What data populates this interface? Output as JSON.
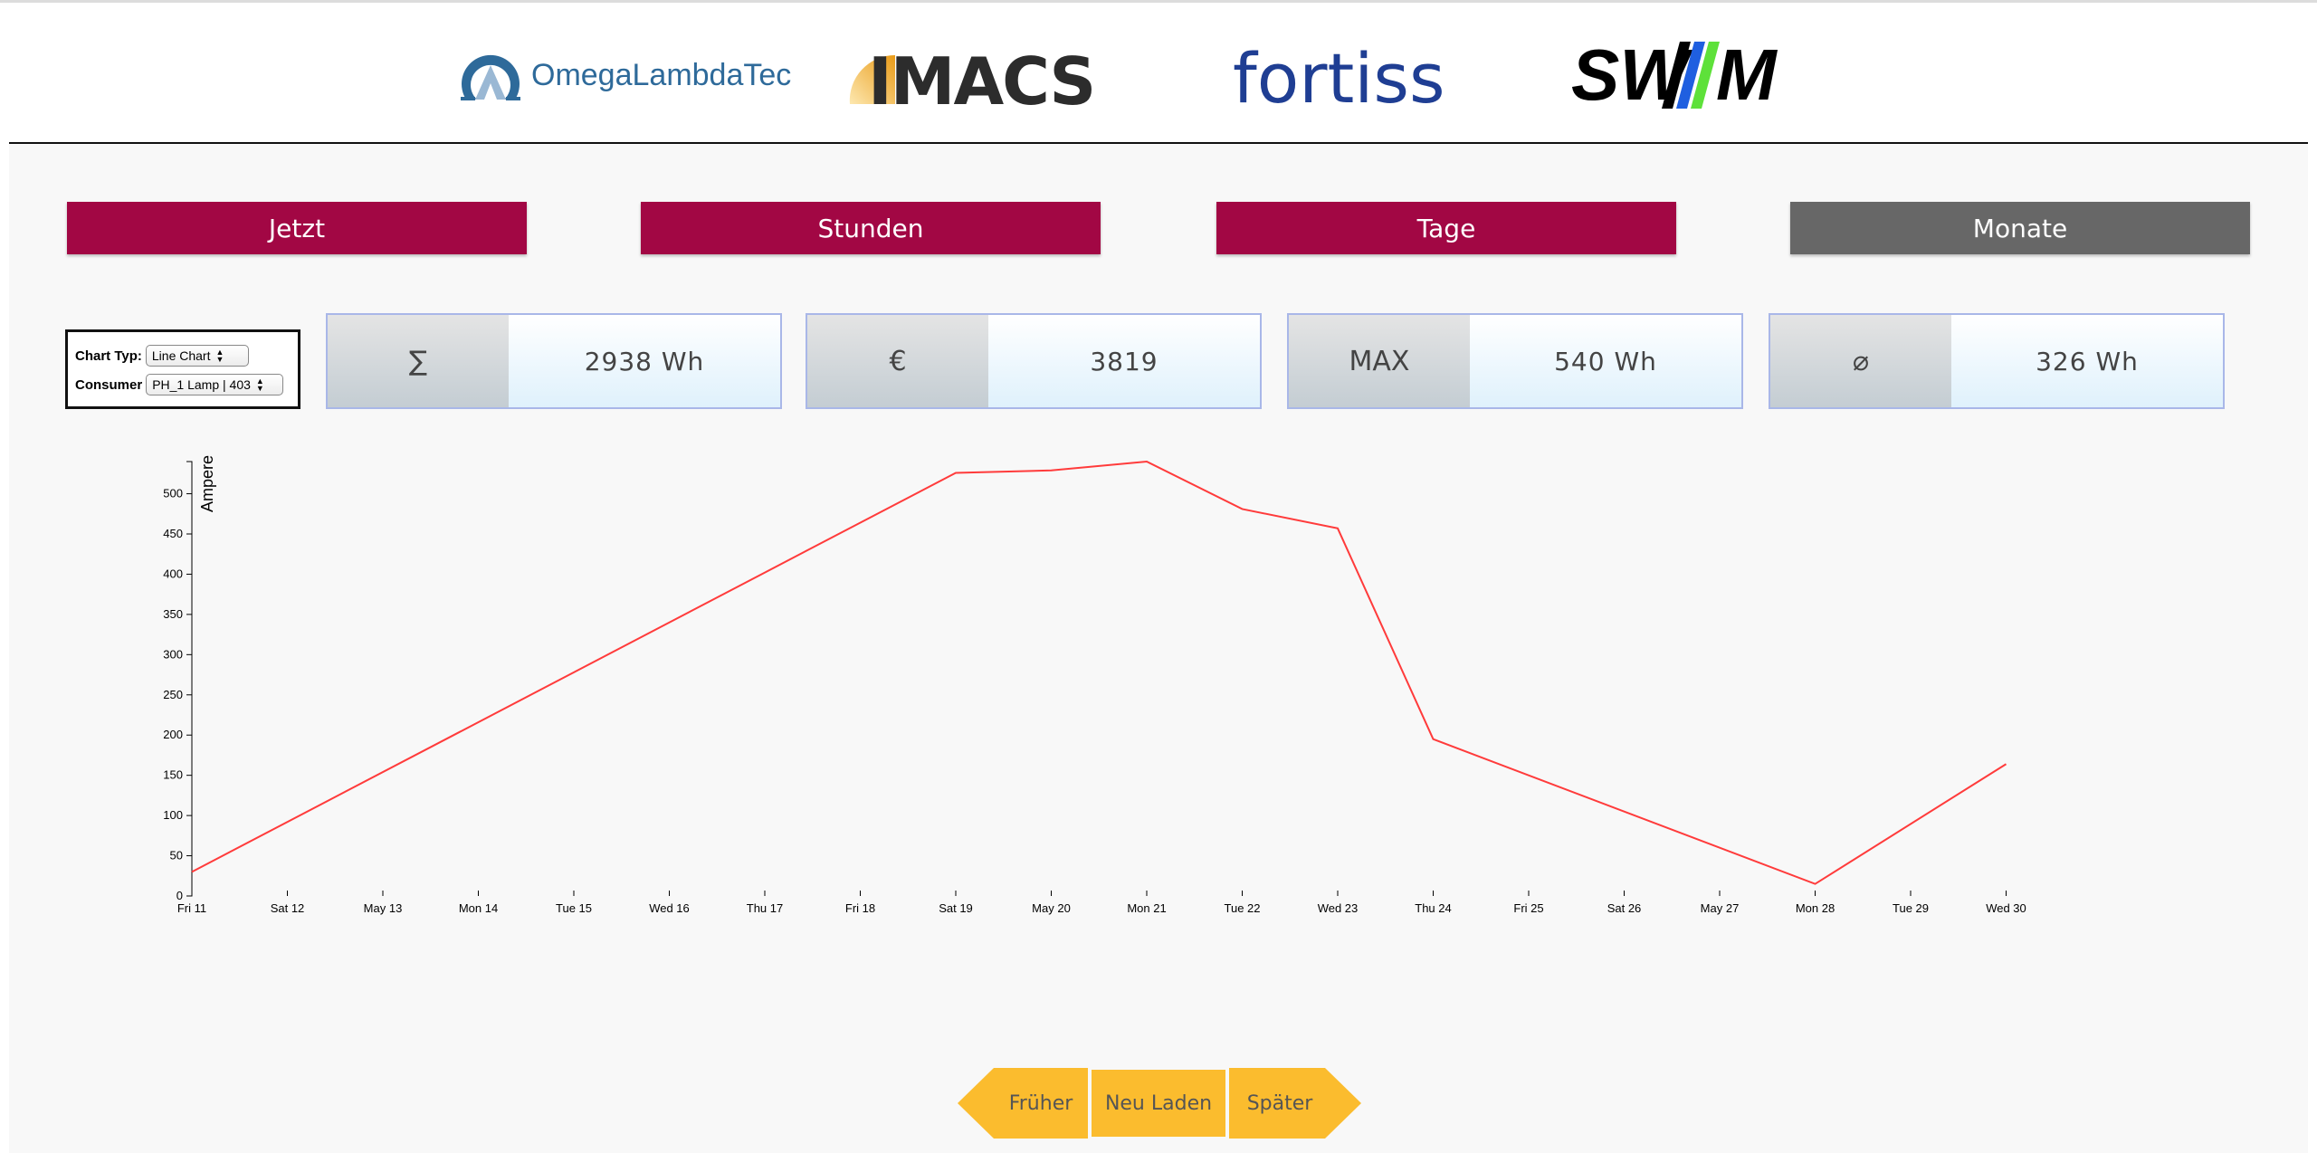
{
  "logos": [
    {
      "name": "OmegaLambdaTec",
      "text": "OmegaLambdaTec"
    },
    {
      "name": "IMACS",
      "text": "IMACS"
    },
    {
      "name": "fortiss",
      "text": "fortiss"
    },
    {
      "name": "SWM",
      "text": "SW//M"
    }
  ],
  "range_buttons": [
    {
      "label": "Jetzt",
      "active": true
    },
    {
      "label": "Stunden",
      "active": true
    },
    {
      "label": "Tage",
      "active": true
    },
    {
      "label": "Monate",
      "active": false
    }
  ],
  "colors": {
    "button_accent": "#a20744",
    "button_disabled": "#676767",
    "nav_button": "#fbbc2e",
    "line": "#ff3b3b",
    "swm_blue": "#1f5fe0",
    "swm_green": "#5ee13a"
  },
  "controls": {
    "chart_type_label": "Chart Typ:",
    "chart_type_value": "Line Chart",
    "consumer_label": "Consumer",
    "consumer_value": "PH_1 Lamp | 403"
  },
  "stats": [
    {
      "icon": "∑",
      "value": "2938 Wh"
    },
    {
      "icon": "€",
      "value": "3819"
    },
    {
      "icon": "MAX",
      "value": "540 Wh"
    },
    {
      "icon": "⌀",
      "value": "326 Wh"
    }
  ],
  "chart_data": {
    "type": "line",
    "ylabel": "Ampere",
    "xlabel": "",
    "ylim": [
      0,
      540
    ],
    "yticks": [
      0,
      50,
      100,
      150,
      200,
      250,
      300,
      350,
      400,
      450,
      500
    ],
    "xticks": [
      "Fri 11",
      "Sat 12",
      "May 13",
      "Mon 14",
      "Tue 15",
      "Wed 16",
      "Thu 17",
      "Fri 18",
      "Sat 19",
      "May 20",
      "Mon 21",
      "Tue 22",
      "Wed 23",
      "Thu 24",
      "Fri 25",
      "Sat 26",
      "May 27",
      "Mon 28",
      "Tue 29",
      "Wed 30"
    ],
    "series": [
      {
        "x": [
          "Fri 11",
          "Sat 19",
          "May 20",
          "Mon 21",
          "Tue 22",
          "Wed 23",
          "Thu 24",
          "Mon 28",
          "Wed 30"
        ],
        "values": [
          30,
          526,
          529,
          540,
          481,
          457,
          195,
          15,
          164
        ]
      }
    ],
    "grid": false
  },
  "nav": {
    "earlier": "Früher",
    "reload": "Neu Laden",
    "later": "Später"
  }
}
